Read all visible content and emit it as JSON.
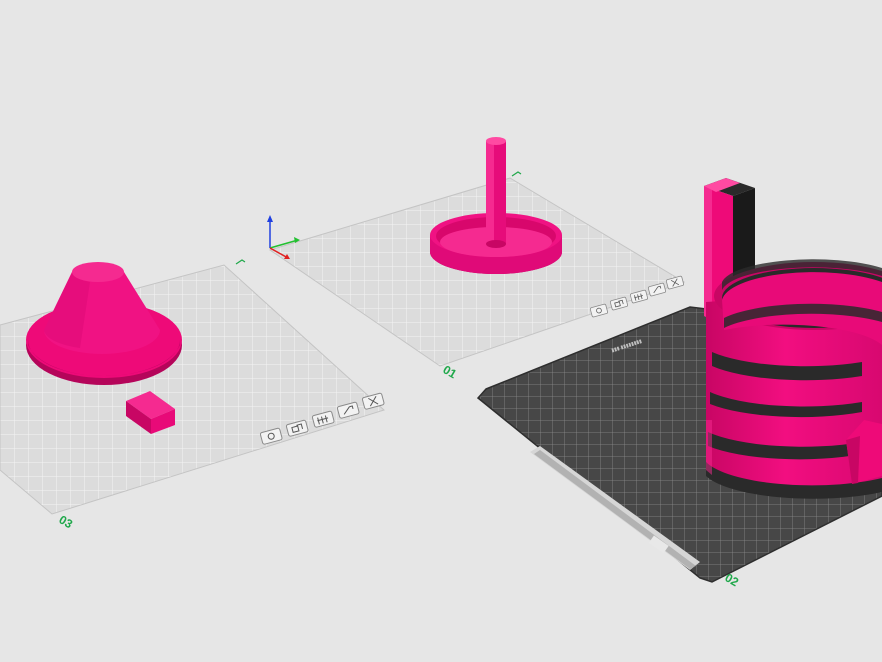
{
  "plates": [
    {
      "id": "plate-01",
      "number": "01",
      "type": "empty",
      "objects": [
        "spool-holder"
      ]
    },
    {
      "id": "plate-02",
      "number": "02",
      "type": "active",
      "objects": [
        "striped-cylinder",
        "tall-block"
      ]
    },
    {
      "id": "plate-03",
      "number": "03",
      "type": "empty",
      "objects": [
        "cone",
        "small-block"
      ]
    }
  ],
  "plate_toolbar_icons": [
    "camera-icon",
    "arrange-icon",
    "grid-icon",
    "settings-icon",
    "close-icon"
  ],
  "axes": {
    "x_color": "#e02020",
    "y_color": "#22c030",
    "z_color": "#2040e0"
  },
  "colors": {
    "model": "#ee0a78",
    "model_dark": "#b5055a",
    "stripe": "#2a2a2a",
    "background": "#e6e6e6",
    "bed": "#444444"
  }
}
